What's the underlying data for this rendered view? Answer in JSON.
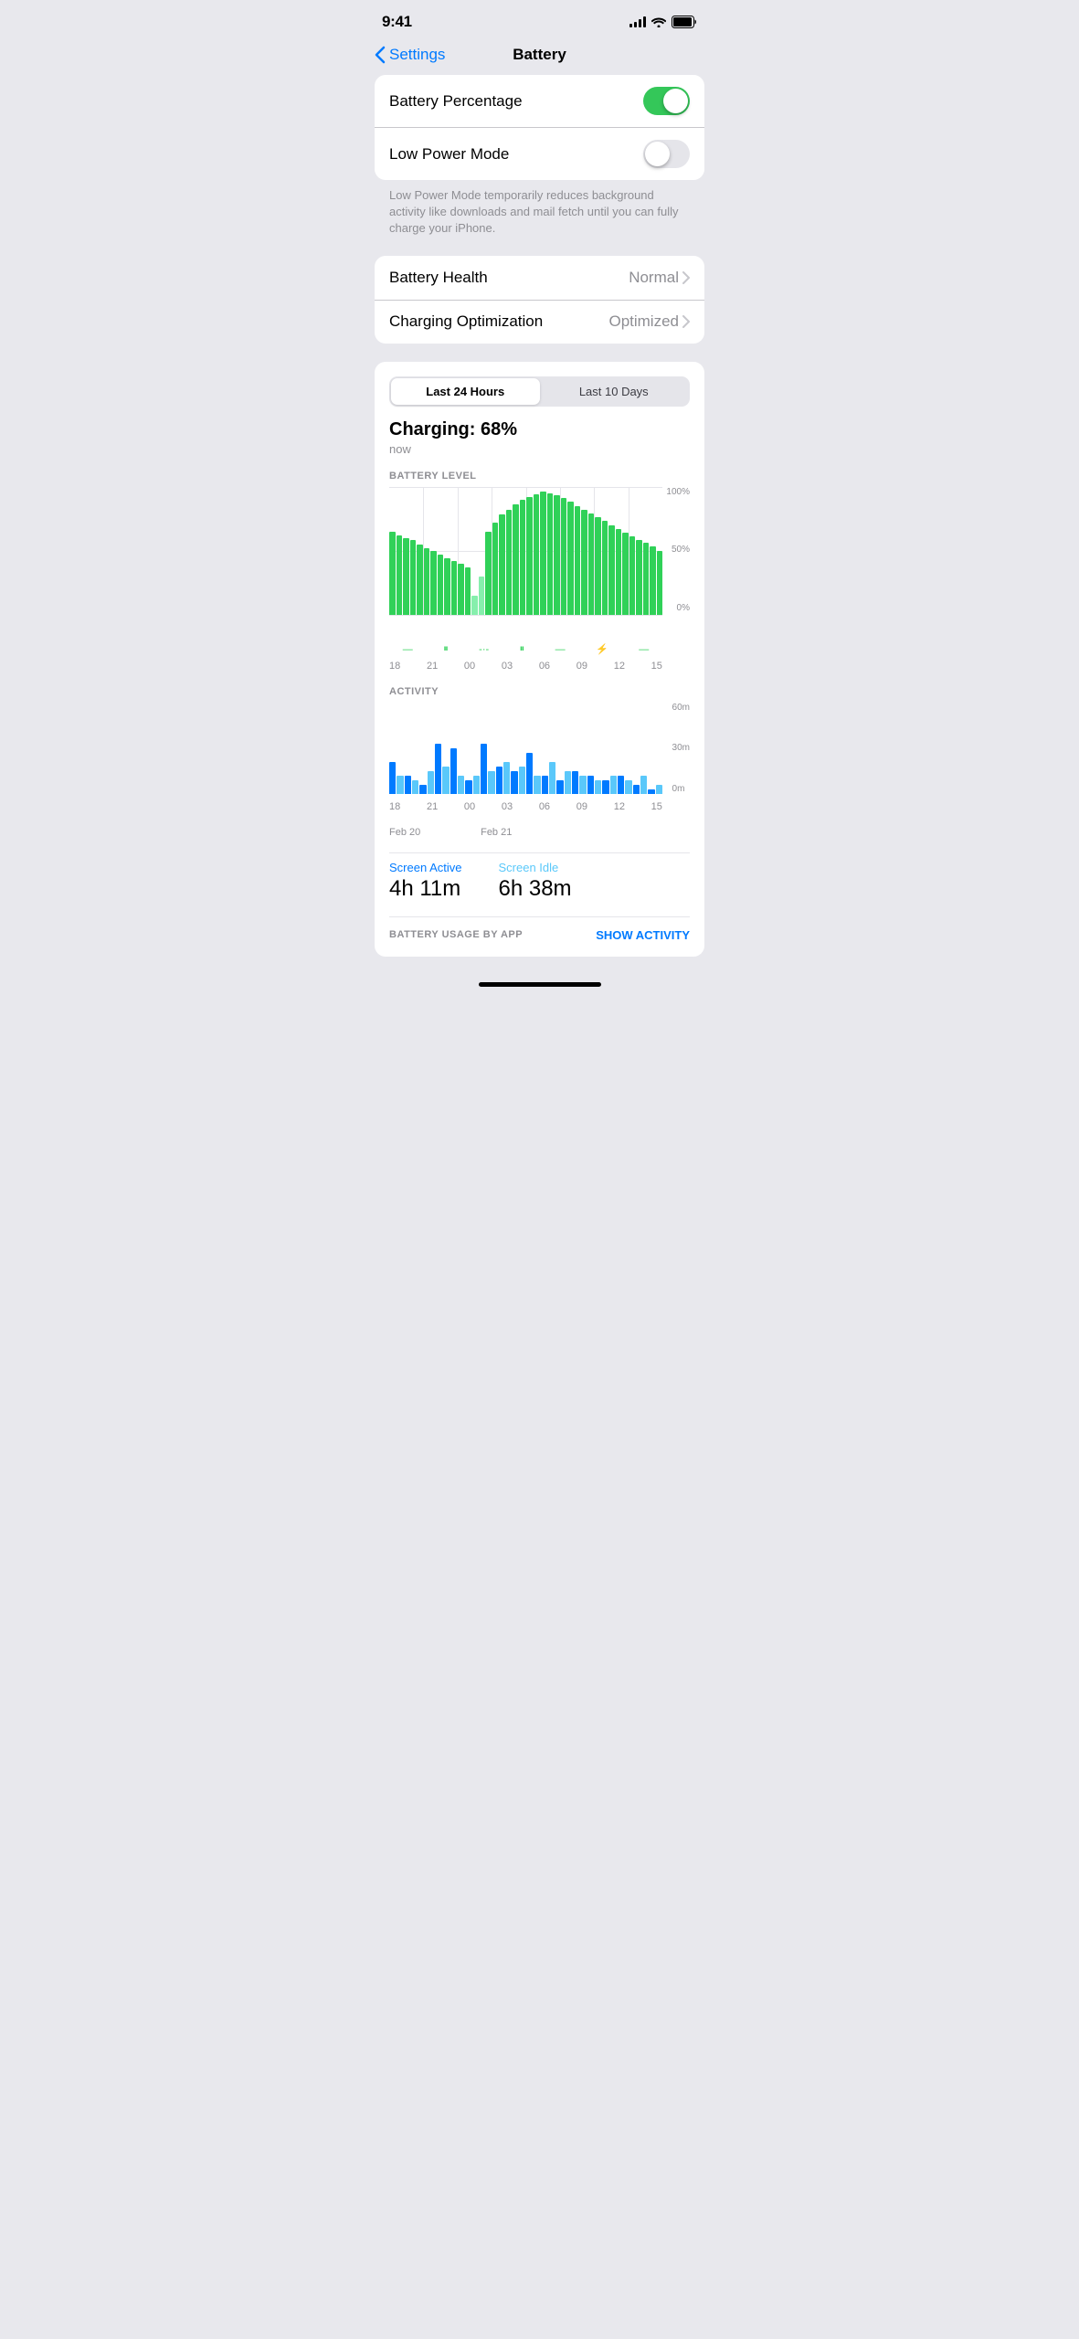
{
  "statusBar": {
    "time": "9:41",
    "batteryIcon": "battery-full"
  },
  "nav": {
    "back": "Settings",
    "title": "Battery"
  },
  "toggles": {
    "batteryPercentage": {
      "label": "Battery Percentage",
      "state": true
    },
    "lowPowerMode": {
      "label": "Low Power Mode",
      "state": false
    },
    "helperText": "Low Power Mode temporarily reduces background activity like downloads and mail fetch until you can fully charge your iPhone."
  },
  "healthRows": [
    {
      "label": "Battery Health",
      "value": "Normal"
    },
    {
      "label": "Charging Optimization",
      "value": "Optimized"
    }
  ],
  "chartCard": {
    "tabs": [
      "Last 24 Hours",
      "Last 10 Days"
    ],
    "activeTab": 0,
    "chargingLabel": "Charging: 68%",
    "chargingTime": "now",
    "batteryLevelLabel": "BATTERY LEVEL",
    "yLabels": [
      "100%",
      "50%",
      "0%"
    ],
    "xLabels": [
      "18",
      "21",
      "00",
      "03",
      "06",
      "09",
      "12",
      "15"
    ],
    "activityLabel": "ACTIVITY",
    "actYLabels": [
      "60m",
      "30m",
      "0m"
    ],
    "actXLabels": [
      "18",
      "21",
      "00",
      "03",
      "06",
      "09",
      "12",
      "15"
    ],
    "dateLabels": [
      "Feb 20",
      "",
      "Feb 21",
      "",
      "",
      "",
      "",
      ""
    ],
    "screenActive": {
      "label": "Screen Active",
      "value": "4h 11m"
    },
    "screenIdle": {
      "label": "Screen Idle",
      "value": "6h 38m"
    },
    "batteryUsageByApp": "BATTERY USAGE BY APP",
    "showActivity": "SHOW ACTIVITY"
  }
}
